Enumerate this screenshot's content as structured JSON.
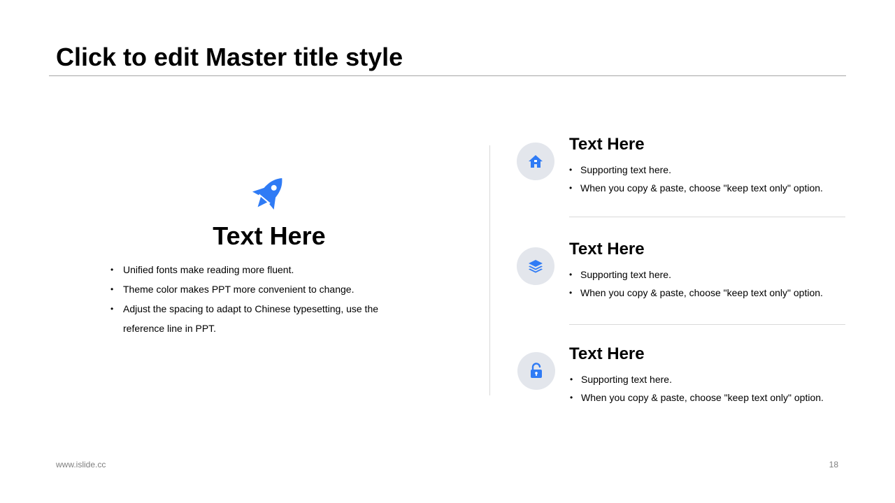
{
  "slide": {
    "title": "Click to edit Master title style",
    "footer_url": "www.islide.cc",
    "page_number": "18",
    "accent_color": "#2F7BF5"
  },
  "left_panel": {
    "icon": "rocket-icon",
    "heading": "Text Here",
    "bullets": [
      "Unified fonts make reading more fluent.",
      "Theme color makes PPT more convenient to change.",
      "Adjust the spacing to adapt to Chinese typesetting, use the reference line in PPT."
    ]
  },
  "right_items": [
    {
      "icon": "home-icon",
      "heading": "Text Here",
      "bullets": [
        "Supporting text here.",
        "When you copy & paste, choose \"keep text only\" option."
      ]
    },
    {
      "icon": "layers-icon",
      "heading": "Text Here",
      "bullets": [
        "Supporting text here.",
        "When you copy & paste, choose \"keep text only\" option."
      ]
    },
    {
      "icon": "unlock-icon",
      "heading": "Text Here",
      "bullets": [
        "Supporting text here.",
        "When you copy & paste, choose \"keep text only\" option."
      ]
    }
  ]
}
